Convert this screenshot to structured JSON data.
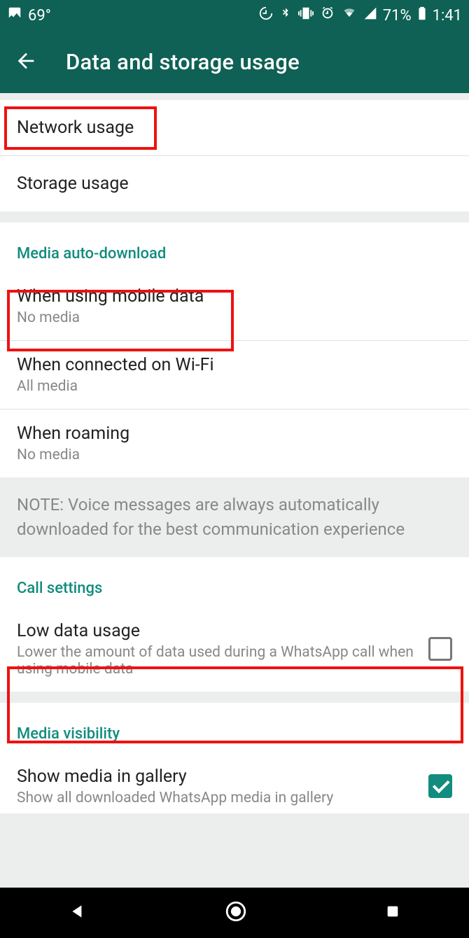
{
  "statusbar": {
    "temperature": "69°",
    "battery": "71%",
    "time": "1:41"
  },
  "appbar": {
    "title": "Data and storage usage"
  },
  "rows": {
    "network_usage": "Network usage",
    "storage_usage": "Storage usage"
  },
  "media_auto_download": {
    "header": "Media auto-download",
    "mobile_data": {
      "title": "When using mobile data",
      "subtitle": "No media"
    },
    "wifi": {
      "title": "When connected on Wi-Fi",
      "subtitle": "All media"
    },
    "roaming": {
      "title": "When roaming",
      "subtitle": "No media"
    },
    "note": "NOTE: Voice messages are always automatically downloaded for the best communication experience"
  },
  "call_settings": {
    "header": "Call settings",
    "low_data": {
      "title": "Low data usage",
      "subtitle": "Lower the amount of data used during a WhatsApp call when using mobile data",
      "checked": false
    }
  },
  "media_visibility": {
    "header": "Media visibility",
    "show_media": {
      "title": "Show media in gallery",
      "subtitle": "Show all downloaded WhatsApp media in gallery",
      "checked": true
    }
  }
}
